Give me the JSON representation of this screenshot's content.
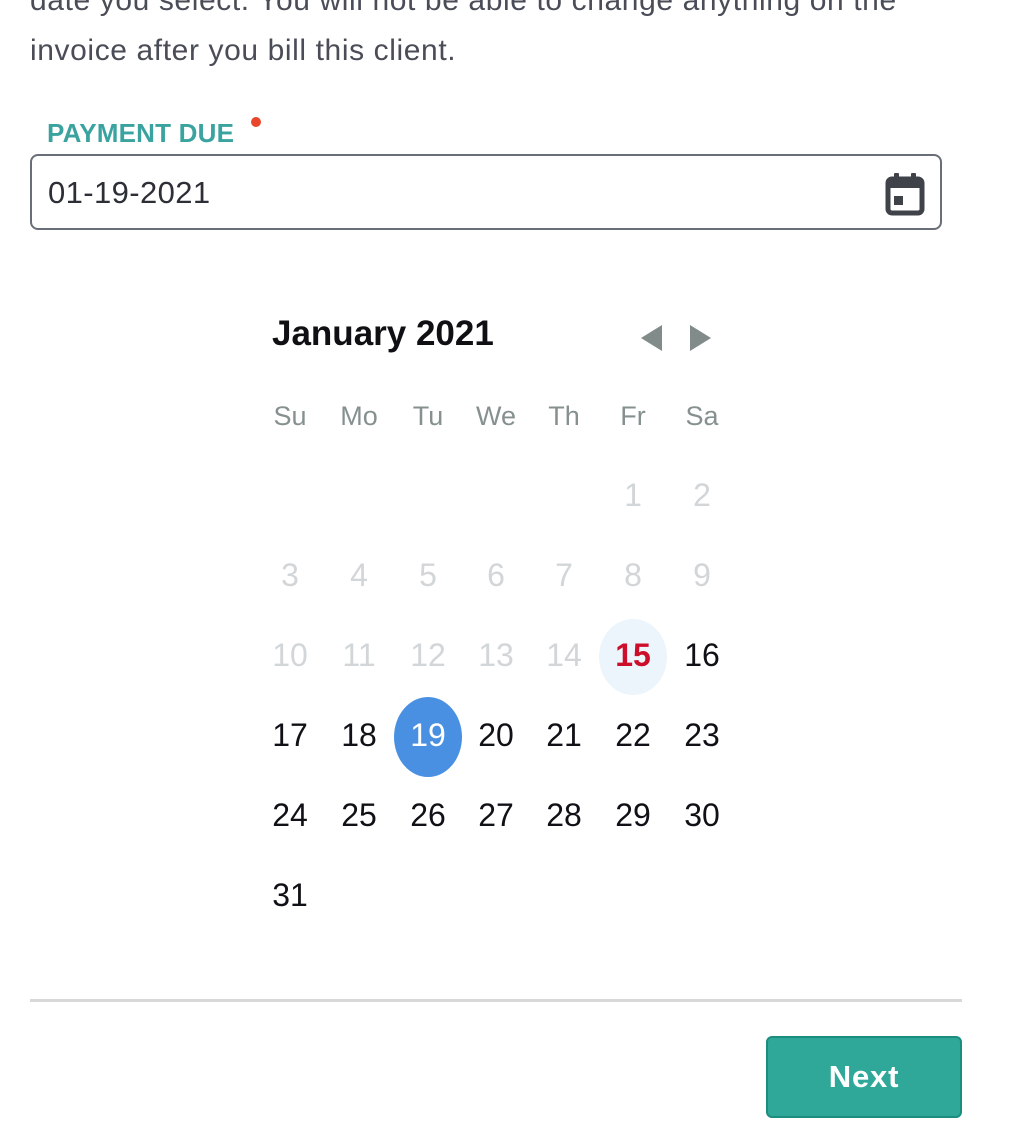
{
  "intro": {
    "line1": "date you select. You will not be able to change anything on the",
    "line2": "invoice after you bill this client."
  },
  "payment_due": {
    "label": "PAYMENT DUE",
    "required": true,
    "value": "01-19-2021",
    "icon": "calendar-icon"
  },
  "calendar": {
    "title": "January 2021",
    "prev_icon": "chevron-left-icon",
    "next_icon": "chevron-right-icon",
    "weekdays": [
      "Su",
      "Mo",
      "Tu",
      "We",
      "Th",
      "Fr",
      "Sa"
    ],
    "first_weekday_index": 5,
    "days_in_month": 31,
    "disabled_days": [
      1,
      2,
      3,
      4,
      5,
      6,
      7,
      8,
      9,
      10,
      11,
      12,
      13,
      14
    ],
    "today": 15,
    "selected": 19,
    "colors": {
      "today": "#cc0e2a",
      "selected": "#4a90e2",
      "disabled": "#d2d6d8"
    }
  },
  "footer": {
    "next_label": "Next",
    "accent": "#2fa899"
  }
}
